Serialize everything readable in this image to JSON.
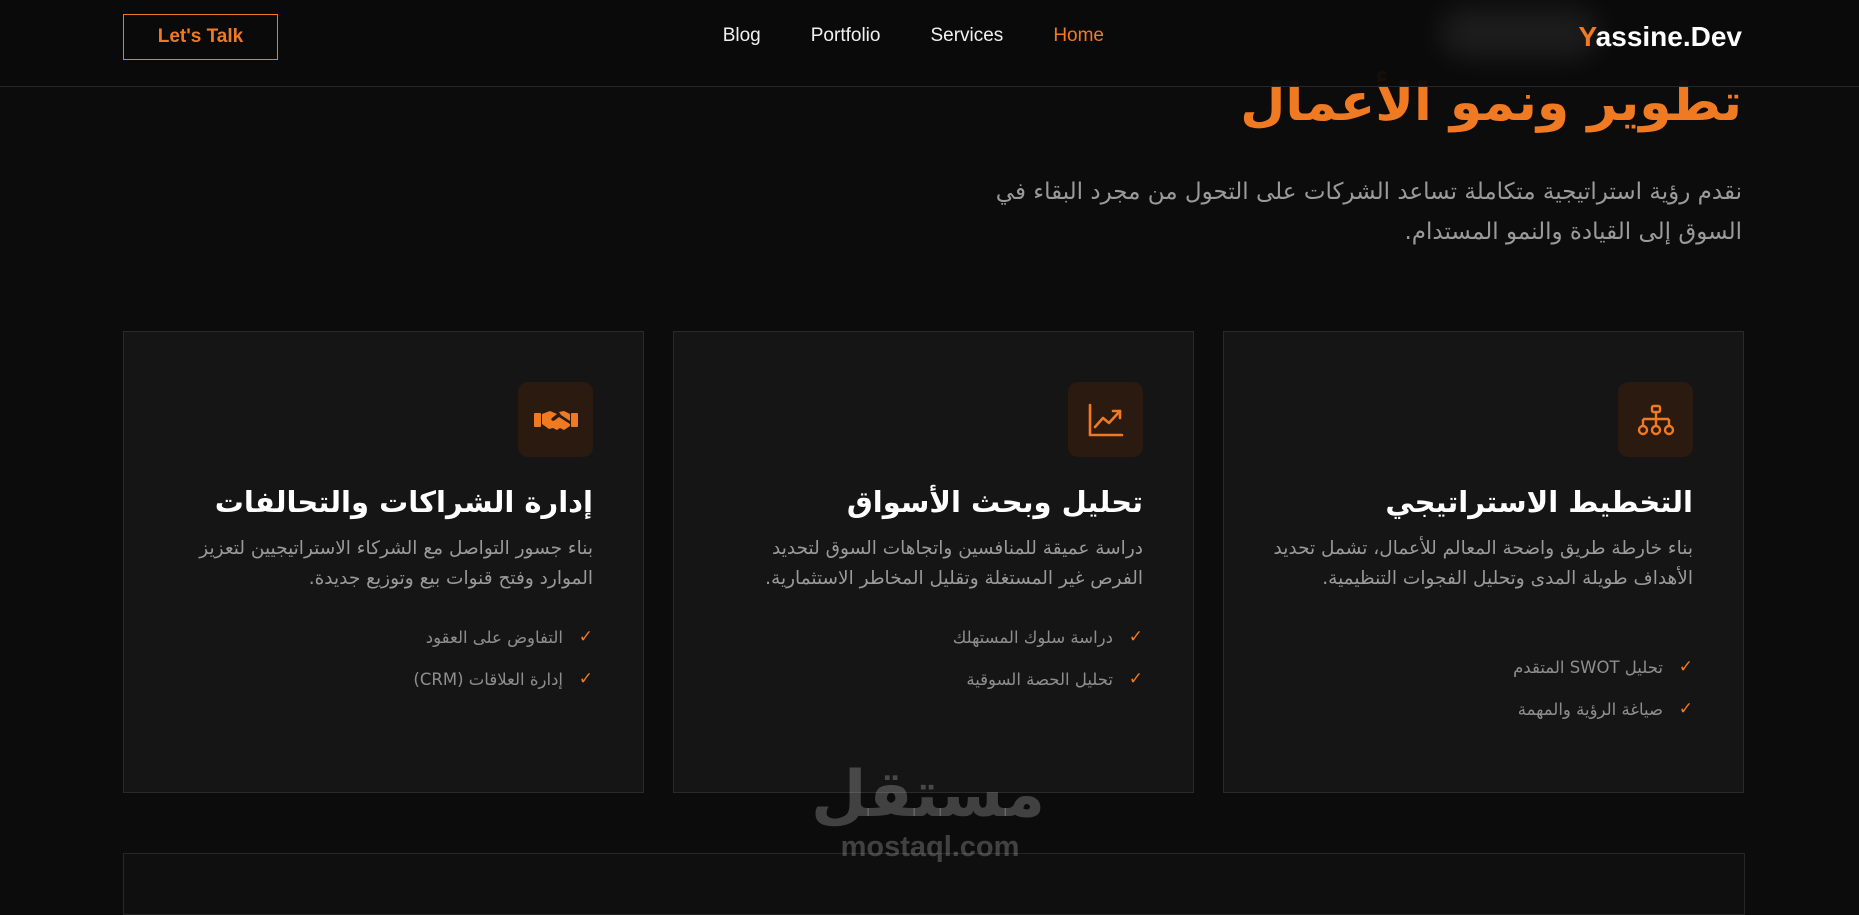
{
  "header": {
    "cta_label": "Let's Talk",
    "nav": [
      "Home",
      "Services",
      "Portfolio",
      "Blog"
    ],
    "active_nav": "Home",
    "logo_first": "Y",
    "logo_rest": "assine.Dev"
  },
  "hero": {
    "title": "تطوير ونمو الأعمال",
    "subtitle": "نقدم رؤية استراتيجية متكاملة تساعد الشركات على التحول من مجرد البقاء في السوق إلى القيادة والنمو المستدام."
  },
  "cards": [
    {
      "icon": "sitemap-icon",
      "title": "التخطيط الاستراتيجي",
      "description": "بناء خارطة طريق واضحة المعالم للأعمال، تشمل تحديد الأهداف طويلة المدى وتحليل الفجوات التنظيمية.",
      "features": [
        "تحليل SWOT المتقدم",
        "صياغة الرؤية والمهمة"
      ]
    },
    {
      "icon": "chart-line-icon",
      "title": "تحليل وبحث الأسواق",
      "description": "دراسة عميقة للمنافسين واتجاهات السوق لتحديد الفرص غير المستغلة وتقليل المخاطر الاستثمارية.",
      "features": [
        "دراسة سلوك المستهلك",
        "تحليل الحصة السوقية"
      ]
    },
    {
      "icon": "handshake-icon",
      "title": "إدارة الشراكات والتحالفات",
      "description": "بناء جسور التواصل مع الشركاء الاستراتيجيين لتعزيز الموارد وفتح قنوات بيع وتوزيع جديدة.",
      "features": [
        "التفاوض على العقود",
        "إدارة العلاقات (CRM)"
      ]
    }
  ],
  "watermark": {
    "arabic": "مستقل",
    "latin": "mostaql.com"
  },
  "colors": {
    "accent": "#f07a22",
    "background": "#0c0c0c",
    "card": "#151515",
    "muted_text": "#9a9a9a"
  }
}
